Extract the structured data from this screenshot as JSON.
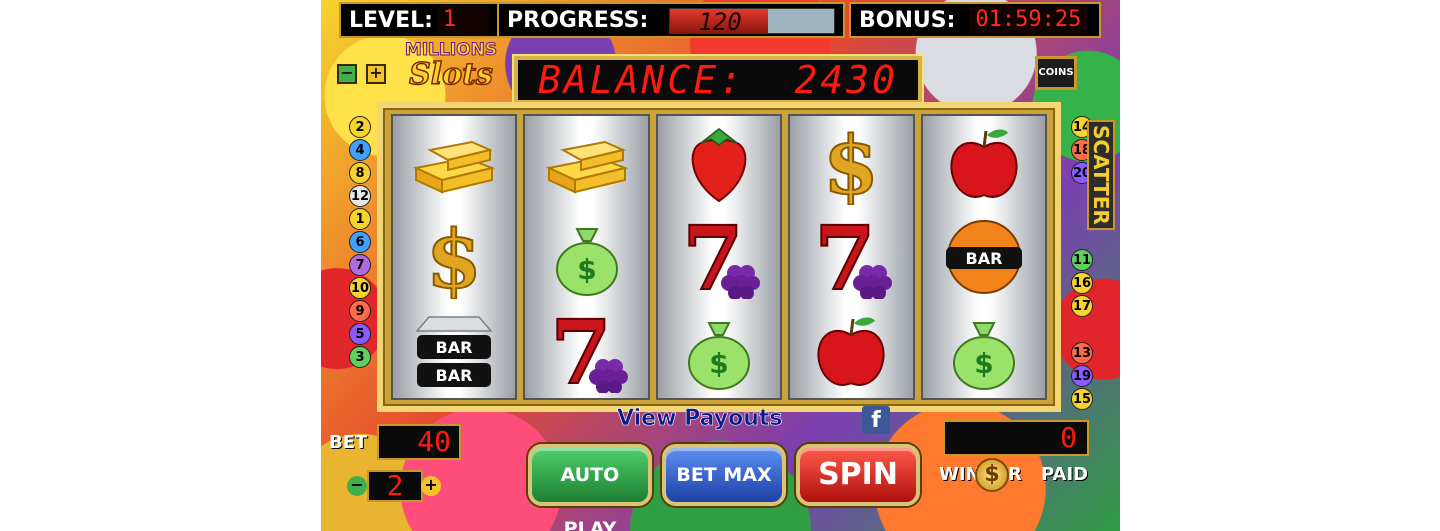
{
  "top_bar": {
    "level_label": "LEVEL:",
    "level_value": "1",
    "progress_label": "PROGRESS:",
    "progress_value": "120",
    "progress_fraction": 0.6,
    "bonus_label": "BONUS:",
    "bonus_value": "01:59:25"
  },
  "logo": {
    "line1": "MILLIONS",
    "line2": "Slots"
  },
  "line_controls": {
    "minus": "−",
    "plus": "+"
  },
  "balance": {
    "label": "BALANCE:",
    "value": "2430"
  },
  "coins_button": "COINS",
  "reels": [
    [
      "gold-bars",
      "dollar-sign",
      "double-bar-diamond"
    ],
    [
      "gold-bars",
      "money-bag",
      "seven-grapes"
    ],
    [
      "strawberry",
      "seven-grapes",
      "money-bag"
    ],
    [
      "dollar-sign",
      "seven-grapes",
      "apple"
    ],
    [
      "apple",
      "orange-bar",
      "money-bag"
    ]
  ],
  "symbol_text": {
    "bar": "BAR",
    "seven": "7",
    "dollar": "$",
    "bag": "$"
  },
  "lines_left": [
    "2",
    "4",
    "8",
    "12",
    "1",
    "6",
    "7",
    "10",
    "9",
    "5",
    "3"
  ],
  "lines_right": [
    "14",
    "18",
    "20",
    "11",
    "16",
    "17",
    "13",
    "19",
    "15"
  ],
  "scatter_label": "SCATTER",
  "view_payouts": "View Payouts",
  "facebook": "f",
  "bet": {
    "label": "BET",
    "value": "40",
    "level": "2",
    "minus": "−",
    "plus": "+"
  },
  "buttons": {
    "autoplay": "AUTO PLAY",
    "betmax": "BET MAX",
    "spin": "SPIN"
  },
  "winner": {
    "value": "0",
    "winner_label": "WINNER",
    "paid_label": "PAID",
    "coin": "$"
  },
  "colors": {
    "led_red": "#ff2a1a",
    "frame_gold": "#c9962a",
    "autoplay_green": "#2f9e44",
    "betmax_blue": "#2a58c9",
    "spin_red": "#d81b14"
  },
  "line_colors": [
    "#f6d32d",
    "#3fa0ff",
    "#f6d32d",
    "#e8e8e8",
    "#f6d32d",
    "#3fa0ff",
    "#b06be0",
    "#f6d32d",
    "#ff6a4a",
    "#8a5cff",
    "#5fcf5f",
    "#f6d32d",
    "#f6d32d",
    "#ff6a4a",
    "#8a5cff",
    "#f6d32d",
    "#ff6a4a",
    "#5fcf5f",
    "#8a5cff",
    "#f6d32d"
  ]
}
